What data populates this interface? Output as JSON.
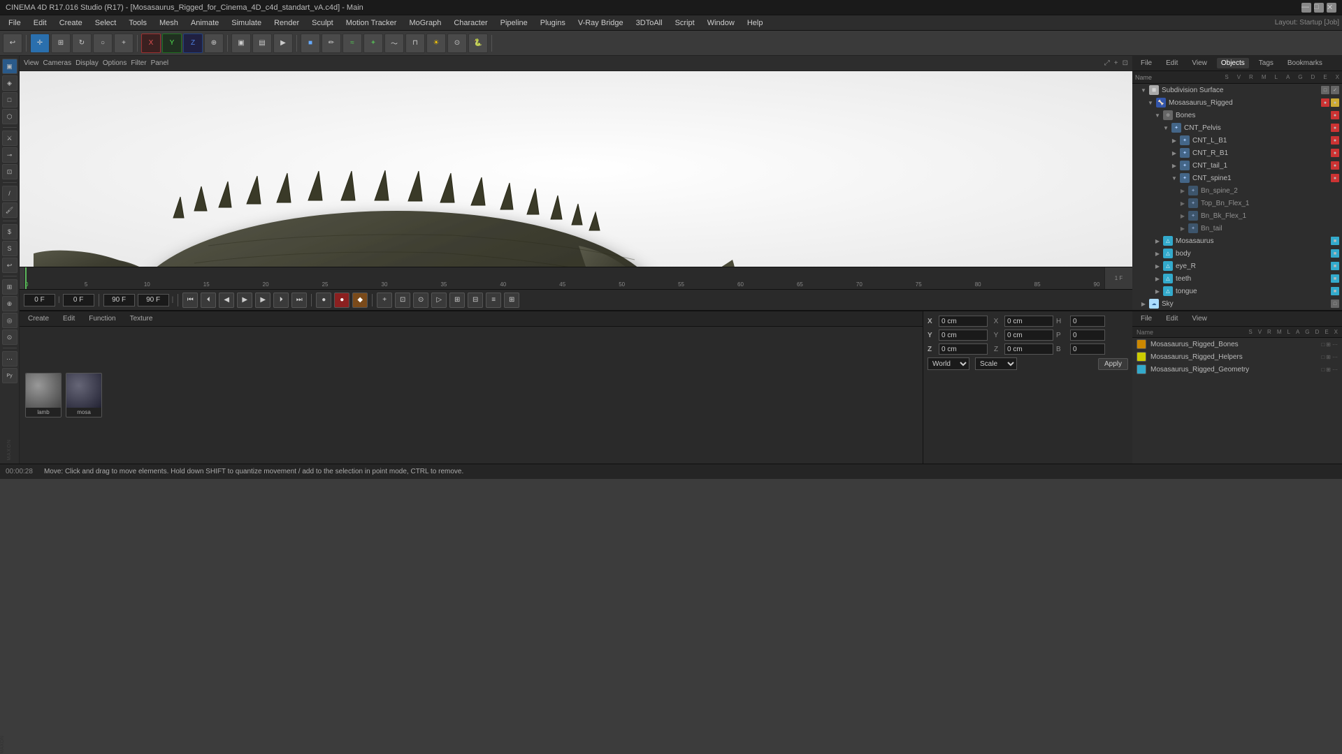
{
  "app": {
    "title": "CINEMA 4D R17.016 Studio (R17) - [Mosasaurus_Rigged_for_Cinema_4D_c4d_standart_vA.c4d] - Main",
    "layout_label": "Layout: Startup [Job]"
  },
  "menu": {
    "items": [
      "File",
      "Edit",
      "Create",
      "Select",
      "Tools",
      "Mesh",
      "Animate",
      "Simulate",
      "Render",
      "Sculpt",
      "Motion Tracker",
      "MoGraph",
      "Character",
      "Pipeline",
      "Plugins",
      "V-Ray Bridge",
      "3DToAll",
      "Script",
      "Window",
      "Help"
    ]
  },
  "viewport": {
    "menus": [
      "View",
      "Cameras",
      "Display",
      "Options",
      "Filter",
      "Panel"
    ]
  },
  "timeline": {
    "start_frame": "0 F",
    "current_frame": "0 F",
    "end_frame": "90 F",
    "ticks": [
      "0",
      "5",
      "10",
      "15",
      "20",
      "25",
      "30",
      "35",
      "40",
      "45",
      "50",
      "55",
      "60",
      "65",
      "70",
      "75",
      "80",
      "85",
      "90"
    ]
  },
  "object_manager": {
    "tabs": [
      "File",
      "Edit",
      "View",
      "Objects",
      "Tags",
      "Bookmarks"
    ],
    "col_headers": [
      "S",
      "V",
      "R",
      "M",
      "L",
      "A",
      "G",
      "D",
      "E",
      "X"
    ],
    "tree": [
      {
        "name": "Subdivision Surface",
        "level": 0,
        "icon_color": "#ffffff",
        "expanded": true,
        "dot": "none"
      },
      {
        "name": "Mosasaurus_Rigged",
        "level": 1,
        "icon_color": "#66aaff",
        "expanded": true,
        "dot": "none"
      },
      {
        "name": "Bones",
        "level": 2,
        "icon_color": "#aaaaaa",
        "expanded": true,
        "dot": "red"
      },
      {
        "name": "CNT_Pelvis",
        "level": 3,
        "icon_color": "#88aacc",
        "expanded": true,
        "dot": "red"
      },
      {
        "name": "CNT_L_B1",
        "level": 4,
        "icon_color": "#88aacc",
        "expanded": false,
        "dot": "red"
      },
      {
        "name": "CNT_R_B1",
        "level": 4,
        "icon_color": "#88aacc",
        "expanded": false,
        "dot": "red"
      },
      {
        "name": "CNT_tail_1",
        "level": 4,
        "icon_color": "#88aacc",
        "expanded": false,
        "dot": "red"
      },
      {
        "name": "CNT_spine1",
        "level": 4,
        "icon_color": "#88aacc",
        "expanded": true,
        "dot": "red"
      },
      {
        "name": "Bn_spine_2",
        "level": 5,
        "icon_color": "#88aacc",
        "expanded": false,
        "dot": "none"
      },
      {
        "name": "Top_Bn_Flex_1",
        "level": 5,
        "icon_color": "#88aacc",
        "expanded": false,
        "dot": "none"
      },
      {
        "name": "Bn_Bk_Flex_1",
        "level": 5,
        "icon_color": "#88aacc",
        "expanded": false,
        "dot": "none"
      },
      {
        "name": "Bn_tail",
        "level": 5,
        "icon_color": "#88aacc",
        "expanded": false,
        "dot": "none"
      },
      {
        "name": "Mosasaurus",
        "level": 2,
        "icon_color": "#33aacc",
        "expanded": false,
        "dot": "cyan"
      },
      {
        "name": "body",
        "level": 2,
        "icon_color": "#33aacc",
        "expanded": false,
        "dot": "cyan"
      },
      {
        "name": "eye_R",
        "level": 2,
        "icon_color": "#33aacc",
        "expanded": false,
        "dot": "cyan"
      },
      {
        "name": "teeth",
        "level": 2,
        "icon_color": "#33aacc",
        "expanded": false,
        "dot": "cyan"
      },
      {
        "name": "tongue",
        "level": 2,
        "icon_color": "#33aacc",
        "expanded": false,
        "dot": "cyan"
      },
      {
        "name": "Sky",
        "level": 0,
        "icon_color": "#aaddff",
        "expanded": false,
        "dot": "none"
      }
    ]
  },
  "material_manager": {
    "tabs": [
      "File",
      "Edit",
      "View"
    ],
    "materials": [
      {
        "name": "Mosasaurus_Rigged_Bones",
        "color": "#cc8800"
      },
      {
        "name": "Mosasaurus_Rigged_Helpers",
        "color": "#cccc00"
      },
      {
        "name": "Mosasaurus_Rigged_Geometry",
        "color": "#33aacc"
      }
    ]
  },
  "bottom_panel": {
    "toolbar_items": [
      "Create",
      "Edit",
      "Function",
      "Texture"
    ],
    "thumbnails": [
      {
        "name": "lamb",
        "color_top": "#888",
        "color_bot": "#444"
      },
      {
        "name": "mosa",
        "color_top": "#556",
        "color_bot": "#333"
      }
    ]
  },
  "coordinates": {
    "x_pos": "0 cm",
    "y_pos": "0 cm",
    "z_pos": "0 cm",
    "x_size": "0 cm",
    "y_size": "0 cm",
    "z_size": "0 cm",
    "h": "0",
    "p": "0",
    "b": "0",
    "coord_system": "World",
    "scale_system": "Scale",
    "apply_label": "Apply"
  },
  "status": {
    "time": "00:00:28",
    "message": "Move: Click and drag to move elements. Hold down SHIFT to quantize movement / add to the selection in point mode, CTRL to remove."
  }
}
